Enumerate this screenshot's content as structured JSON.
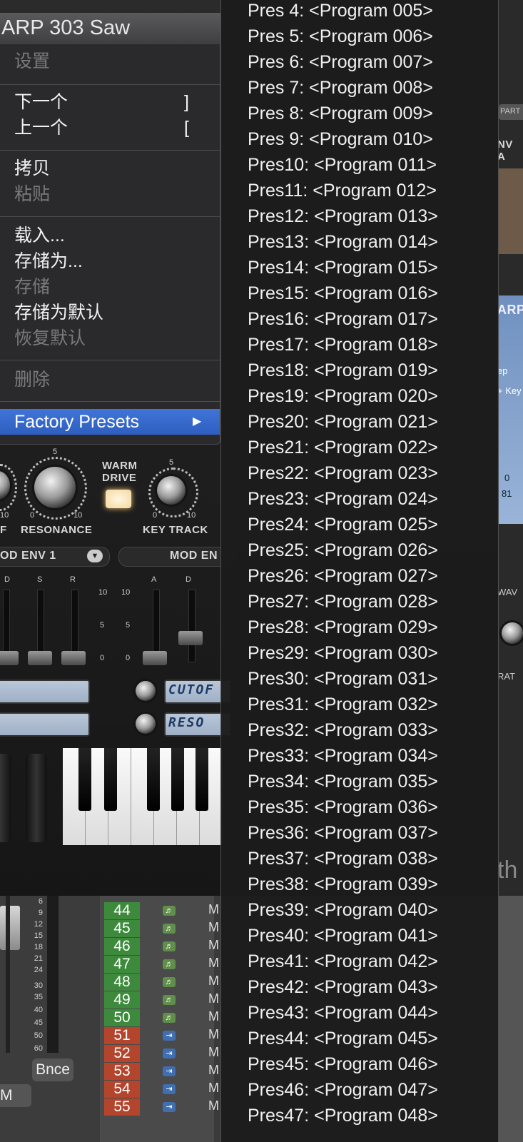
{
  "window": {
    "title": "ARP 303 Saw"
  },
  "context_menu": {
    "items": [
      {
        "label": "设置",
        "disabled": true
      },
      {
        "label": "下一个",
        "shortcut": "]",
        "disabled": false
      },
      {
        "label": "上一个",
        "shortcut": "[",
        "disabled": false
      },
      {
        "label": "拷贝",
        "disabled": false
      },
      {
        "label": "粘贴",
        "disabled": true
      },
      {
        "label": "载入...",
        "disabled": false
      },
      {
        "label": "存储为...",
        "disabled": false
      },
      {
        "label": "存储",
        "disabled": true
      },
      {
        "label": "存储为默认",
        "disabled": false
      },
      {
        "label": "恢复默认",
        "disabled": true
      },
      {
        "label": "删除",
        "disabled": true
      }
    ],
    "factory_presets": {
      "label": "Factory Presets",
      "arrow": "▶"
    }
  },
  "synth": {
    "labels": {
      "resonance": "RESONANCE",
      "warm_drive_1": "WARM",
      "warm_drive_2": "DRIVE",
      "key_track": "KEY TRACK",
      "mod_env_1": "OD ENV 1",
      "mod_env_2": "MOD EN",
      "adsr_d": "D",
      "adsr_s": "S",
      "adsr_r": "R",
      "adsr_a2": "A",
      "adsr_d2": "D",
      "cutoff_short": "F",
      "lcd_cutoff": "CUTOF",
      "lcd_reso": "RESO",
      "knob_num_5": "5",
      "knob_num_0": "0",
      "knob_num_10": "10",
      "slider_10": "10",
      "slider_5": "5",
      "slider_0": "0"
    },
    "right_strip": {
      "part": "PART",
      "env": "NV A",
      "arp": "ARP",
      "step": "ep",
      "key": "+ Key",
      "val0": "0",
      "val81": "81",
      "wav": "WAV",
      "rat": "RAT",
      "ath": "th"
    }
  },
  "mixer": {
    "meter_scale": [
      "6",
      "9",
      "12",
      "15",
      "18",
      "21",
      "24",
      "30",
      "35",
      "40",
      "45",
      "50",
      "60"
    ],
    "bounce_label": "Bnce",
    "m_label": "M",
    "tracks": [
      {
        "num": "44",
        "type": "midi",
        "name": "M"
      },
      {
        "num": "45",
        "type": "midi",
        "name": "M"
      },
      {
        "num": "46",
        "type": "midi",
        "name": "M"
      },
      {
        "num": "47",
        "type": "midi",
        "name": "M"
      },
      {
        "num": "48",
        "type": "midi",
        "name": "M"
      },
      {
        "num": "49",
        "type": "midi",
        "name": "M"
      },
      {
        "num": "50",
        "type": "midi",
        "name": "M"
      },
      {
        "num": "51",
        "type": "audio",
        "name": "M"
      },
      {
        "num": "52",
        "type": "audio",
        "name": "M"
      },
      {
        "num": "53",
        "type": "audio",
        "name": "M"
      },
      {
        "num": "54",
        "type": "audio",
        "name": "M"
      },
      {
        "num": "55",
        "type": "audio",
        "name": "M"
      }
    ]
  },
  "preset_menu": {
    "items": [
      "Pres 4: <Program 005>",
      "Pres 5: <Program 006>",
      "Pres 6: <Program 007>",
      "Pres 7: <Program 008>",
      "Pres 8: <Program 009>",
      "Pres 9: <Program 010>",
      "Pres10: <Program 011>",
      "Pres11: <Program 012>",
      "Pres12: <Program 013>",
      "Pres13: <Program 014>",
      "Pres14: <Program 015>",
      "Pres15: <Program 016>",
      "Pres16: <Program 017>",
      "Pres17: <Program 018>",
      "Pres18: <Program 019>",
      "Pres19: <Program 020>",
      "Pres20: <Program 021>",
      "Pres21: <Program 022>",
      "Pres22: <Program 023>",
      "Pres23: <Program 024>",
      "Pres24: <Program 025>",
      "Pres25: <Program 026>",
      "Pres26: <Program 027>",
      "Pres27: <Program 028>",
      "Pres28: <Program 029>",
      "Pres29: <Program 030>",
      "Pres30: <Program 031>",
      "Pres31: <Program 032>",
      "Pres32: <Program 033>",
      "Pres33: <Program 034>",
      "Pres34: <Program 035>",
      "Pres35: <Program 036>",
      "Pres36: <Program 037>",
      "Pres37: <Program 038>",
      "Pres38: <Program 039>",
      "Pres39: <Program 040>",
      "Pres40: <Program 041>",
      "Pres41: <Program 042>",
      "Pres42: <Program 043>",
      "Pres43: <Program 044>",
      "Pres44: <Program 045>",
      "Pres45: <Program 046>",
      "Pres46: <Program 047>",
      "Pres47: <Program 048>"
    ]
  },
  "colors": {
    "menu_highlight": "#3f74d6",
    "track_midi": "#3d8a3d",
    "track_audio": "#b3452c",
    "lcd_text": "#1e3a66"
  }
}
